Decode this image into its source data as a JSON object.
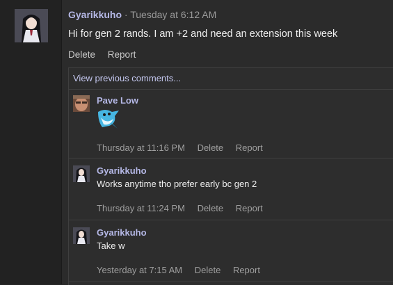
{
  "post": {
    "author": "Gyarikkuho",
    "separator": "·",
    "time": "Tuesday at 6:12 AM",
    "text": "Hi for gen 2 rands. I am +2 and need an extension this week",
    "actions": [
      "Delete",
      "Report"
    ]
  },
  "comments": {
    "view_previous": "View previous comments...",
    "items": [
      {
        "author": "Pave Low",
        "text": "",
        "time": "Thursday at 11:16 PM",
        "actions": [
          "Delete",
          "Report"
        ]
      },
      {
        "author": "Gyarikkuho",
        "text": "Works anytime tho prefer early bc gen 2",
        "time": "Thursday at 11:24 PM",
        "actions": [
          "Delete",
          "Report"
        ]
      },
      {
        "author": "Gyarikkuho",
        "text": "Take w",
        "time": "Yesterday at 7:15 AM",
        "actions": [
          "Delete",
          "Report"
        ]
      }
    ]
  },
  "colors": {
    "author": "#b5b8e6",
    "link": "#c4c7ef",
    "background": "#2b2b2b"
  }
}
